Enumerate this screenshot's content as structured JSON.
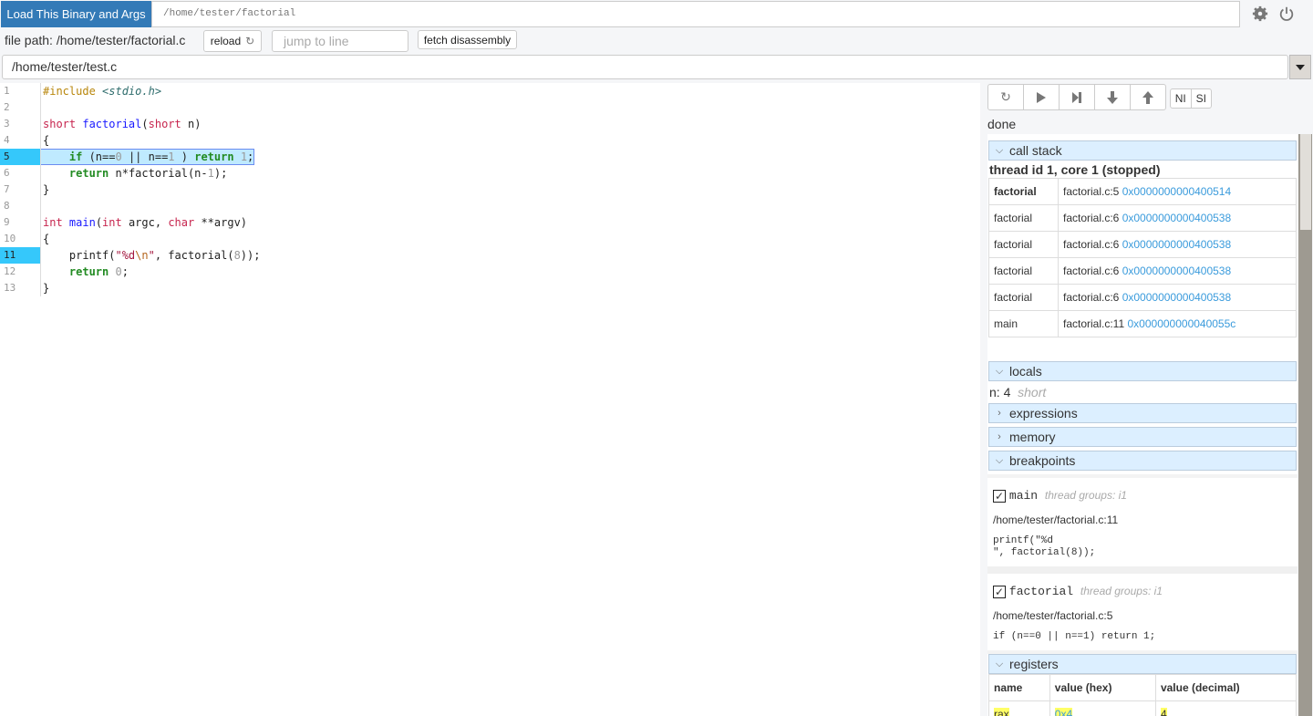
{
  "top": {
    "load_button": "Load This Binary and Args",
    "binary_path": "/home/tester/factorial"
  },
  "toolbar": {
    "file_path": "file path: /home/tester/factorial.c",
    "reload": "reload",
    "jump_placeholder": "jump to line",
    "fetch": "fetch disassembly",
    "source_select": "/home/tester/test.c"
  },
  "code": {
    "current_line": 5,
    "breakpoint_lines": [
      5,
      11
    ],
    "lines": [
      [
        [
          "e",
          "#include "
        ],
        [
          "h",
          "<stdio.h>"
        ]
      ],
      [],
      [
        [
          "k",
          "short "
        ],
        [
          "f",
          "factorial"
        ],
        [
          "",
          "("
        ],
        [
          "k",
          "short"
        ],
        [
          "",
          " n)"
        ]
      ],
      [
        [
          "",
          "{"
        ]
      ],
      [
        [
          "",
          "    "
        ],
        [
          "r",
          "if"
        ],
        [
          "",
          " (n=="
        ],
        [
          "n",
          "0"
        ],
        [
          "",
          " || n=="
        ],
        [
          "n",
          "1"
        ],
        [
          "",
          " ) "
        ],
        [
          "r",
          "return"
        ],
        [
          "",
          " "
        ],
        [
          "n",
          "1"
        ],
        [
          "",
          ";"
        ]
      ],
      [
        [
          "",
          "    "
        ],
        [
          "r",
          "return"
        ],
        [
          "",
          " n*factorial(n-"
        ],
        [
          "n",
          "1"
        ],
        [
          "",
          ");"
        ]
      ],
      [
        [
          "",
          "}"
        ]
      ],
      [],
      [
        [
          "k",
          "int "
        ],
        [
          "f",
          "main"
        ],
        [
          "",
          "("
        ],
        [
          "k",
          "int"
        ],
        [
          "",
          " argc, "
        ],
        [
          "k",
          "char"
        ],
        [
          "",
          " **argv)"
        ]
      ],
      [
        [
          "",
          "{"
        ]
      ],
      [
        [
          "",
          "    printf("
        ],
        [
          "s",
          "\"%d"
        ],
        [
          "m",
          "\\n"
        ],
        [
          "s",
          "\""
        ],
        [
          "",
          ", factorial("
        ],
        [
          "n",
          "8"
        ],
        [
          "",
          "));"
        ]
      ],
      [
        [
          "",
          "    "
        ],
        [
          "r",
          "return"
        ],
        [
          "",
          " "
        ],
        [
          "n",
          "0"
        ],
        [
          "",
          ";"
        ]
      ],
      [
        [
          "",
          "}"
        ]
      ]
    ]
  },
  "controls": {
    "ni": "NI",
    "si": "SI",
    "status": "done"
  },
  "call_stack": {
    "title": "call stack",
    "thread": "thread id 1, core 1 (stopped)",
    "frames": [
      {
        "func": "factorial",
        "loc": "factorial.c:5",
        "addr": "0x0000000000400514"
      },
      {
        "func": "factorial",
        "loc": "factorial.c:6",
        "addr": "0x0000000000400538"
      },
      {
        "func": "factorial",
        "loc": "factorial.c:6",
        "addr": "0x0000000000400538"
      },
      {
        "func": "factorial",
        "loc": "factorial.c:6",
        "addr": "0x0000000000400538"
      },
      {
        "func": "factorial",
        "loc": "factorial.c:6",
        "addr": "0x0000000000400538"
      },
      {
        "func": "main",
        "loc": "factorial.c:11",
        "addr": "0x000000000040055c"
      }
    ]
  },
  "locals": {
    "title": "locals",
    "items": [
      {
        "name": "n: 4",
        "type": "short"
      }
    ]
  },
  "expressions": {
    "title": "expressions"
  },
  "memory": {
    "title": "memory"
  },
  "breakpoints": {
    "title": "breakpoints",
    "items": [
      {
        "func": "main",
        "groups": "thread groups: i1",
        "file": "/home/tester/factorial.c:11",
        "src1": "printf(\"%d",
        "src2": "\", factorial(8));"
      },
      {
        "func": "factorial",
        "groups": "thread groups: i1",
        "file": "/home/tester/factorial.c:5",
        "src1": "if (n==0 || n==1) return 1;",
        "src2": ""
      }
    ]
  },
  "registers": {
    "title": "registers",
    "headers": [
      "name",
      "value (hex)",
      "value (decimal)"
    ],
    "rows": [
      [
        "rax",
        "0x4",
        "4"
      ]
    ]
  }
}
